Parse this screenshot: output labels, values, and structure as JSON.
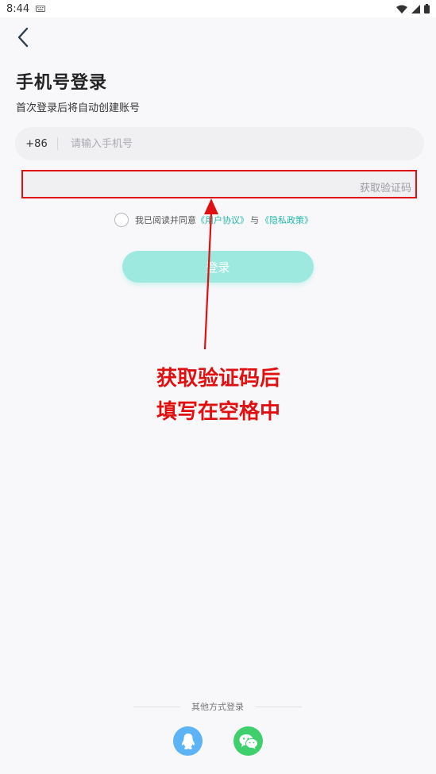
{
  "status_bar": {
    "time": "8:44"
  },
  "header": {
    "title": "手机号登录",
    "subtitle": "首次登录后将自动创建账号"
  },
  "phone": {
    "country_code": "+86",
    "placeholder": "请输入手机号",
    "value": ""
  },
  "code": {
    "value": "",
    "get_code_label": "获取验证码"
  },
  "agreement": {
    "prefix": "我已阅读并同意",
    "user_agreement": "《用户协议》",
    "and": "与",
    "privacy_policy": "《隐私政策》"
  },
  "login_label": "登录",
  "annotation": {
    "line1": "获取验证码后",
    "line2": "填写在空格中",
    "color": "#e01010"
  },
  "other_login": {
    "label": "其他方式登录",
    "methods": [
      "qq-icon",
      "wechat-icon"
    ]
  },
  "colors": {
    "accent": "#23b8a8",
    "login_button": "#9de9df",
    "qq": "#5cb3f5",
    "wechat": "#3fcf6d"
  }
}
